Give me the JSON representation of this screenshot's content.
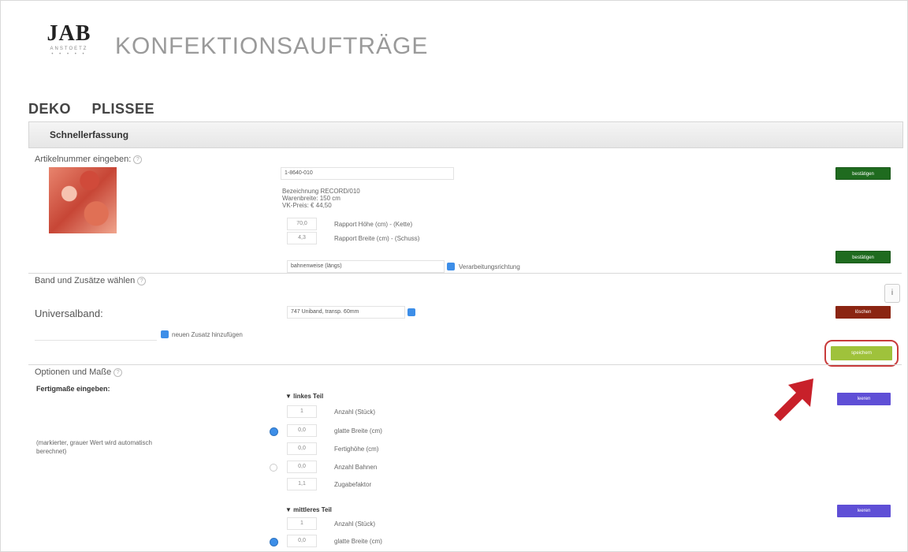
{
  "logo": {
    "brand": "JAB",
    "sub": "ANSTOETZ",
    "dots": "• • • • •"
  },
  "app_title": "KONFEKTIONSAUFTRÄGE",
  "tabs": [
    "DEKO",
    "PLISSEE"
  ],
  "panel": {
    "title": "Schnellerfassung"
  },
  "article": {
    "label": "Artikelnummer eingeben:",
    "number": "1-8640-010",
    "details": [
      "Bezeichnung RECORD/010",
      "Warenbreite: 150 cm",
      "VK-Preis:    € 44,50"
    ],
    "rapport_hoehe_value": "70,0",
    "rapport_hoehe_label": "Rapport Höhe (cm) - (Kette)",
    "rapport_breite_value": "4,3",
    "rapport_breite_label": "Rapport Breite (cm) - (Schuss)",
    "processing_value": "bahnenweise (längs)",
    "processing_label": "Verarbeitungsrichtung",
    "confirm_label": "bestätigen",
    "confirm_label_2": "bestätigen"
  },
  "band": {
    "label": "Band und Zusätze wählen",
    "universal_label": "Universalband:",
    "universal_value": "747 Uniband, transp. 60mm",
    "add_label": "neuen Zusatz hinzufügen",
    "delete_label": "löschen",
    "save_label": "speichern"
  },
  "options": {
    "label": "Optionen und Maße",
    "finished_label": "Fertigmaße eingeben:",
    "note": "(markierter, grauer Wert wird automatisch berechnet)",
    "left": {
      "title": "▼ linkes Teil",
      "count_value": "1",
      "count_label": "Anzahl (Stück)",
      "width_value": "0,0",
      "width_label": "glatte Breite (cm)",
      "height_value": "0,0",
      "height_label": "Fertighöhe (cm)",
      "lanes_value": "0,0",
      "lanes_label": "Anzahl Bahnen",
      "factor_value": "1,1",
      "factor_label": "Zugabefaktor",
      "clear_label": "leeren"
    },
    "middle": {
      "title": "▼ mittleres Teil",
      "count_value": "1",
      "count_label": "Anzahl (Stück)",
      "width_value": "0,0",
      "width_label": "glatte Breite (cm)",
      "clear_label": "leeren"
    }
  },
  "side_badge": "i",
  "colors": {
    "green": "#1f6b1f",
    "red": "#8b2512",
    "lime": "#9fc23b",
    "purple": "#5f4fd6",
    "accent": "#3d8ee8",
    "highlight": "#c83b3b"
  }
}
